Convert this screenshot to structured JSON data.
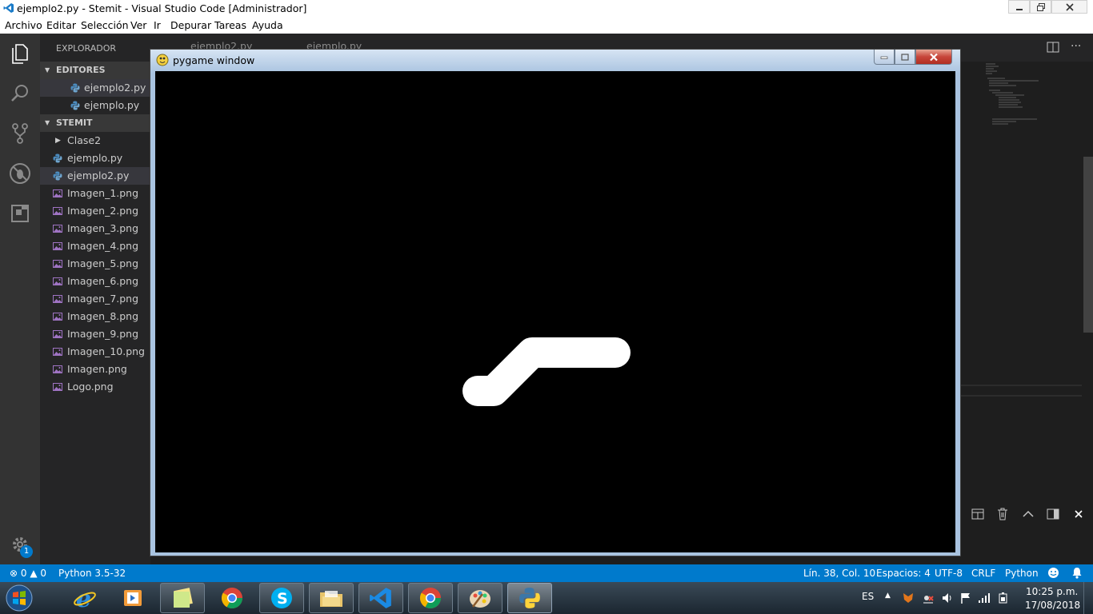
{
  "window": {
    "title": "ejemplo2.py - Stemit - Visual Studio Code [Administrador]"
  },
  "menu": [
    "Archivo",
    "Editar",
    "Selección",
    "Ver",
    "Ir",
    "Depurar",
    "Tareas",
    "Ayuda"
  ],
  "activity_bar": {
    "icons": [
      "explorer-icon",
      "search-icon",
      "source-control-icon",
      "debug-icon",
      "extensions-icon"
    ],
    "settings_badge": "1"
  },
  "sidebar": {
    "title": "EXPLORADOR",
    "open_editors": {
      "header": "EDITORES ABIERTOS",
      "items": [
        "ejemplo2.py",
        "ejemplo.py"
      ]
    },
    "project": {
      "header": "STEMIT",
      "folder": "Clase2",
      "files": [
        {
          "name": "ejemplo.py",
          "type": "python"
        },
        {
          "name": "ejemplo2.py",
          "type": "python"
        },
        {
          "name": "Imagen_1.png",
          "type": "image"
        },
        {
          "name": "Imagen_2.png",
          "type": "image"
        },
        {
          "name": "Imagen_3.png",
          "type": "image"
        },
        {
          "name": "Imagen_4.png",
          "type": "image"
        },
        {
          "name": "Imagen_5.png",
          "type": "image"
        },
        {
          "name": "Imagen_6.png",
          "type": "image"
        },
        {
          "name": "Imagen_7.png",
          "type": "image"
        },
        {
          "name": "Imagen_8.png",
          "type": "image"
        },
        {
          "name": "Imagen_9.png",
          "type": "image"
        },
        {
          "name": "Imagen_10.png",
          "type": "image"
        },
        {
          "name": "Imagen.png",
          "type": "image"
        },
        {
          "name": "Logo.png",
          "type": "image"
        }
      ]
    }
  },
  "tabs": [
    "ejemplo2.py",
    "ejemplo.py"
  ],
  "pygame": {
    "title": "pygame window"
  },
  "status_bar": {
    "errors": "0",
    "warnings": "0",
    "interpreter": "Python 3.5-32",
    "position": "Lín. 38, Col. 10",
    "spaces": "Espacios: 4",
    "encoding": "UTF-8",
    "eol": "CRLF",
    "language": "Python"
  },
  "taskbar": {
    "apps": [
      "internet-explorer",
      "media-player",
      "file-explorer-folder",
      "chrome",
      "skype",
      "file-manager",
      "visual-studio-code",
      "chrome-2",
      "paint",
      "python"
    ],
    "language": "ES",
    "time": "10:25 p.m.",
    "date": "17/08/2018"
  },
  "colors": {
    "accent": "#007acc",
    "sidebar_bg": "#252526",
    "activity_bg": "#333333",
    "editor_bg": "#1e1e1e"
  }
}
